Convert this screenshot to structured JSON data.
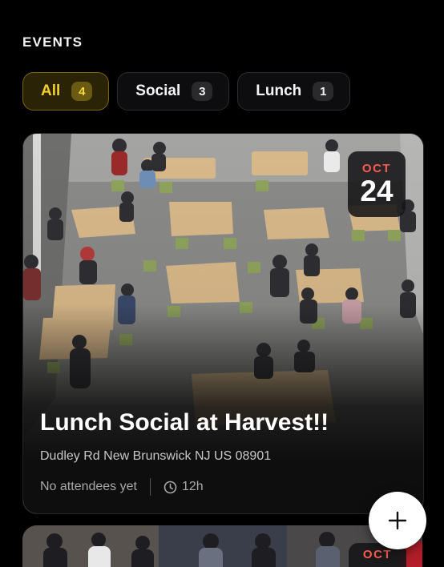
{
  "header": {
    "section_title": "EVENTS"
  },
  "filters": [
    {
      "label": "All",
      "count": "4",
      "active": true
    },
    {
      "label": "Social",
      "count": "3",
      "active": false
    },
    {
      "label": "Lunch",
      "count": "1",
      "active": false
    }
  ],
  "events": [
    {
      "title": "Lunch Social at Harvest!!",
      "address": "Dudley Rd New Brunswick NJ US 08901",
      "attendees": "No attendees yet",
      "duration": "12h",
      "date_month": "OCT",
      "date_day": "24"
    },
    {
      "date_month": "OCT"
    }
  ],
  "fab": {
    "icon": "plus-icon"
  },
  "colors": {
    "background": "#000000",
    "active_chip_text": "#f1cf2b",
    "active_chip_bg": "#2a2306",
    "date_month": "#ff5a52",
    "fab_bg": "#ffffff"
  }
}
